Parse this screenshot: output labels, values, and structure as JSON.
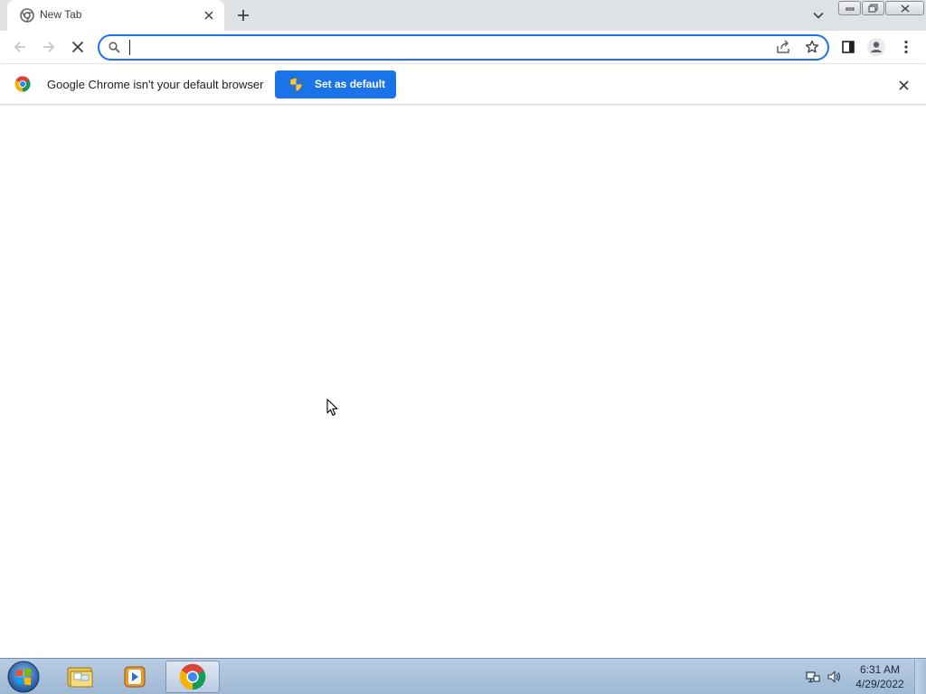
{
  "tab": {
    "title": "New Tab"
  },
  "omnibox": {
    "value": "",
    "placeholder": ""
  },
  "infobar": {
    "message": "Google Chrome isn't your default browser",
    "button_label": "Set as default"
  },
  "taskbar": {
    "apps": [
      "windows-explorer",
      "media-player",
      "google-chrome"
    ],
    "time": "6:31 AM",
    "date": "4/29/2022"
  },
  "colors": {
    "accent": "#1a73e8",
    "tabstrip": "#dee1e6",
    "taskbar": "#a9c1dc"
  }
}
